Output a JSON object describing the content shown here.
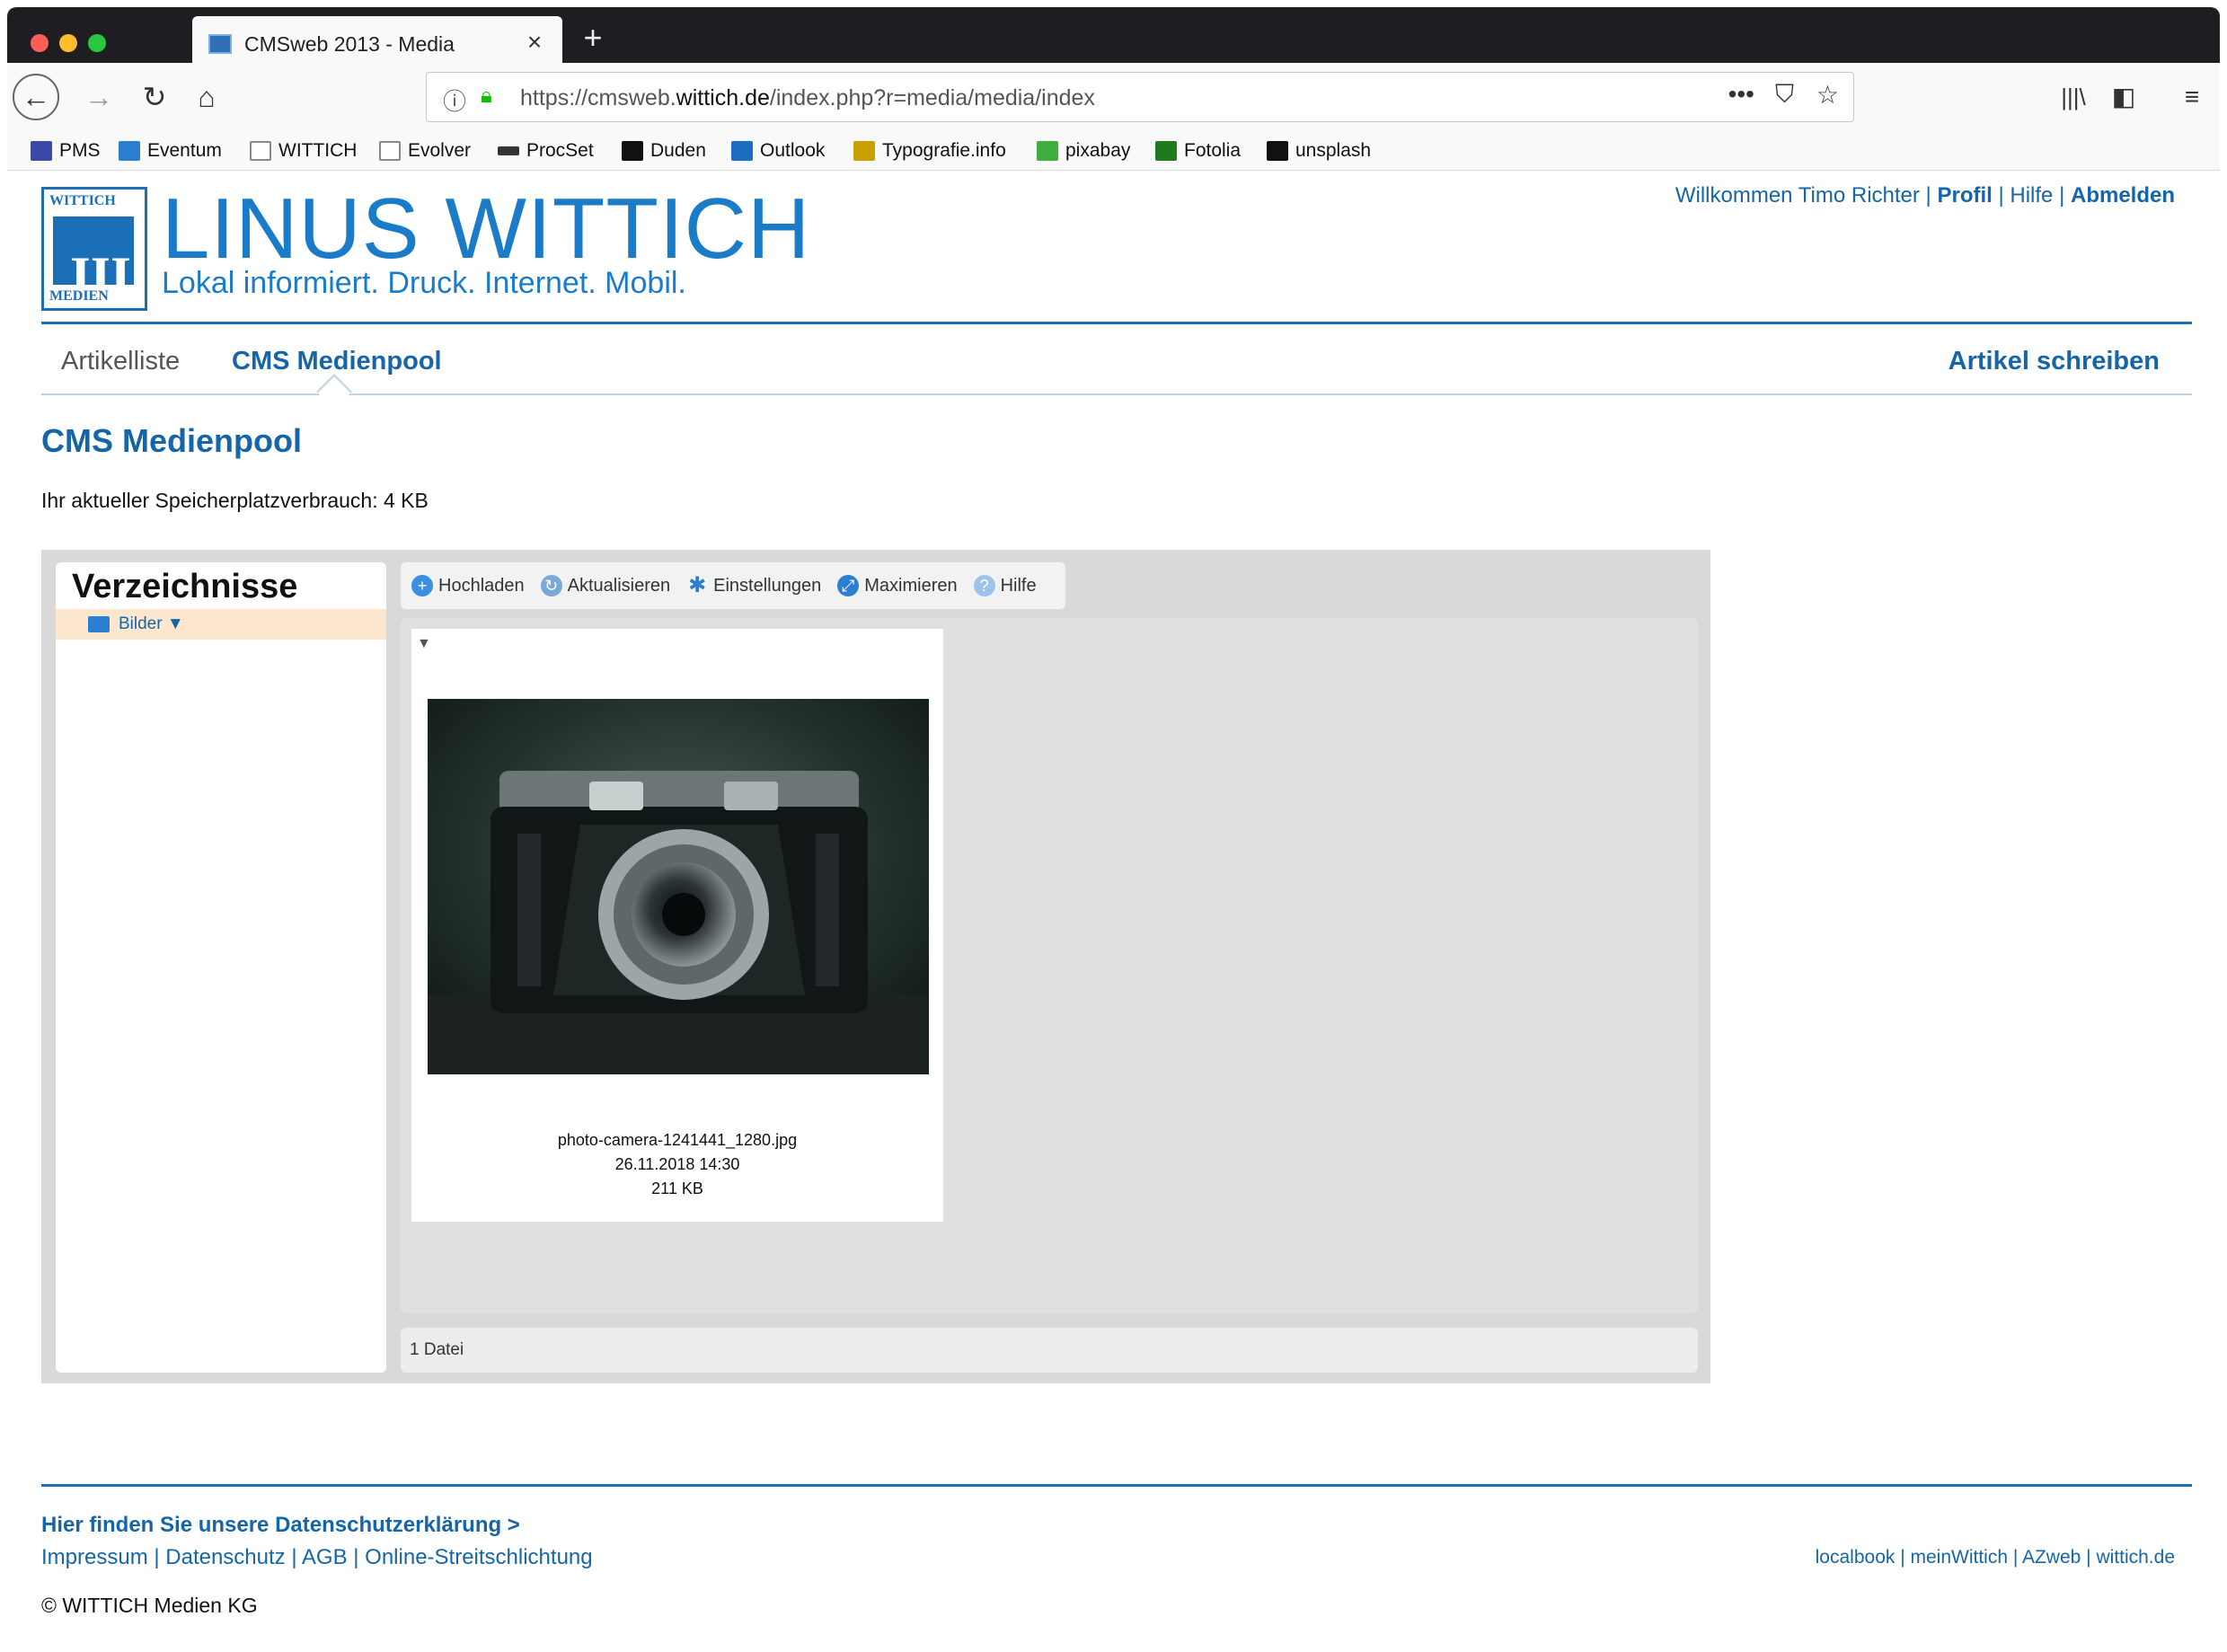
{
  "browser": {
    "tab_title": "CMSweb 2013 - Media",
    "tab_close": "×",
    "new_tab": "+",
    "url_prefix": "https://cmsweb.",
    "url_domain": "wittich.de",
    "url_path": "/index.php?r=media/media/index",
    "page_actions": "•••",
    "bookmarks": [
      {
        "label": "PMS",
        "color": "#3b4aa8"
      },
      {
        "label": "Eventum",
        "color": "#2a7fd0"
      },
      {
        "label": "WITTICH",
        "color": "#9a9a9a"
      },
      {
        "label": "Evolver",
        "color": "#9a9a9a"
      },
      {
        "label": "ProcSet",
        "color": "#333333"
      },
      {
        "label": "Duden",
        "color": "#111111"
      },
      {
        "label": "Outlook",
        "color": "#1b6ec2"
      },
      {
        "label": "Typografie.info",
        "color": "#c8a000"
      },
      {
        "label": "pixabay",
        "color": "#3fae3f"
      },
      {
        "label": "Fotolia",
        "color": "#1f7a1f"
      },
      {
        "label": "unsplash",
        "color": "#111111"
      }
    ]
  },
  "header": {
    "logo_top": "WITTICH",
    "logo_bottom": "MEDIEN",
    "brand": "LINUS WITTICH",
    "tagline": "Lokal informiert. Druck. Internet. Mobil.",
    "welcome": "Willkommen Timo Richter",
    "profile": "Profil",
    "help": "Hilfe",
    "logout": "Abmelden"
  },
  "nav": {
    "article_list": "Artikelliste",
    "media_pool": "CMS Medienpool",
    "write_article": "Artikel schreiben"
  },
  "main": {
    "title": "CMS Medienpool",
    "usage": "Ihr aktueller Speicherplatzverbrauch: 4 KB"
  },
  "mediapool": {
    "dir_title": "Verzeichnisse",
    "folder": "Bilder ▼",
    "toolbar": {
      "upload": "Hochladen",
      "refresh": "Aktualisieren",
      "settings": "Einstellungen",
      "maximize": "Maximieren",
      "help": "Hilfe"
    },
    "file": {
      "name": "photo-camera-1241441_1280.jpg",
      "date": "26.11.2018 14:30",
      "size": "211 KB"
    },
    "status": "1 Datei"
  },
  "footer": {
    "privacy": "Hier finden Sie unsere Datenschutzerklärung >",
    "links": "Impressum | Datenschutz | AGB | Online-Streitschlichtung",
    "right_links": "localbook | meinWittich | AZweb | wittich.de",
    "copyright": "© WITTICH Medien KG"
  },
  "colors": {
    "brand_blue": "#1a7cc9",
    "link_blue": "#1565a8"
  }
}
